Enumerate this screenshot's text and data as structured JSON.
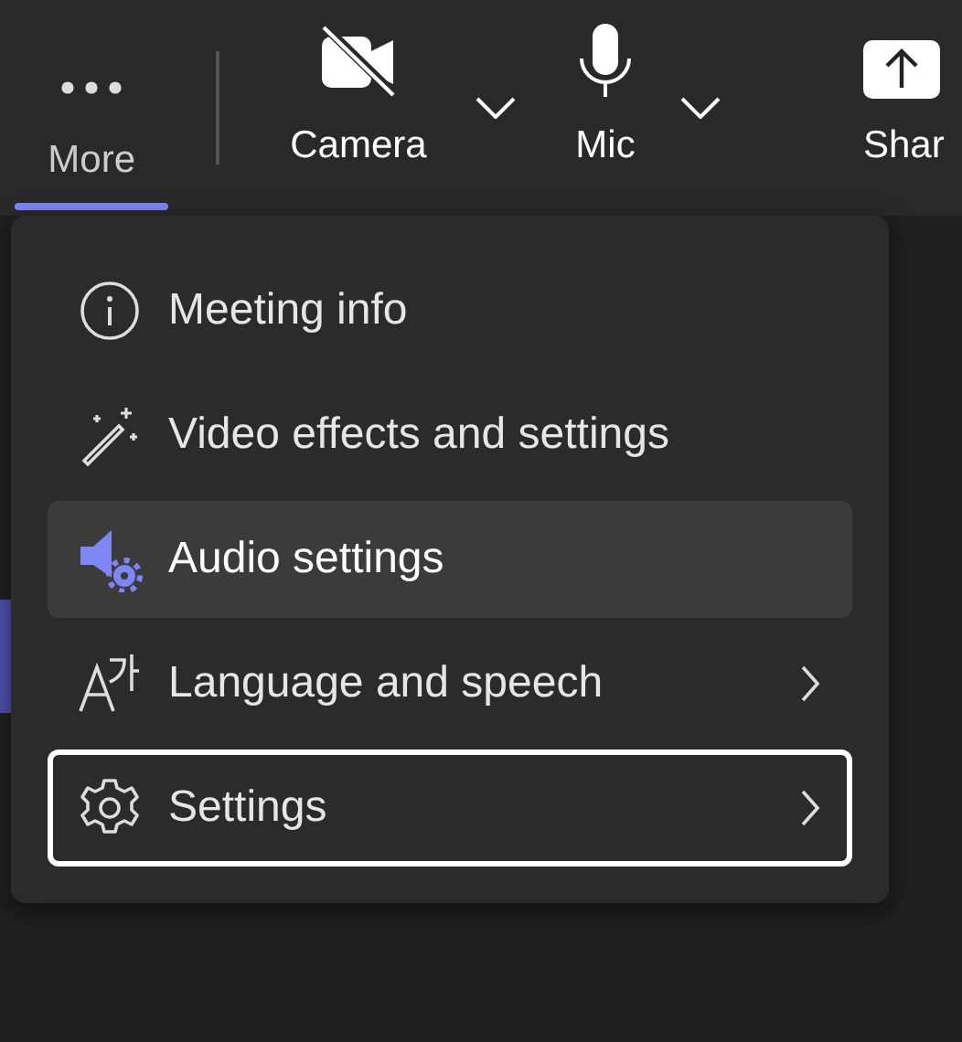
{
  "toolbar": [
    {
      "kind": "more",
      "label": "More",
      "selected": true
    },
    {
      "kind": "camera",
      "label": "Camera",
      "off": true,
      "dropdown": true
    },
    {
      "kind": "mic",
      "label": "Mic",
      "off": false,
      "dropdown": true
    },
    {
      "kind": "share",
      "label": "Shar"
    }
  ],
  "menu": {
    "items": [
      {
        "kind": "info",
        "label": "Meeting info",
        "selected": false,
        "focused": false,
        "submenu": false
      },
      {
        "kind": "effects",
        "label": "Video effects and settings",
        "selected": false,
        "focused": false,
        "submenu": false
      },
      {
        "kind": "audio",
        "label": "Audio settings",
        "selected": true,
        "focused": false,
        "submenu": false
      },
      {
        "kind": "language",
        "label": "Language and speech",
        "selected": false,
        "focused": false,
        "submenu": true
      },
      {
        "kind": "settings",
        "label": "Settings",
        "selected": false,
        "focused": true,
        "submenu": true
      }
    ]
  }
}
